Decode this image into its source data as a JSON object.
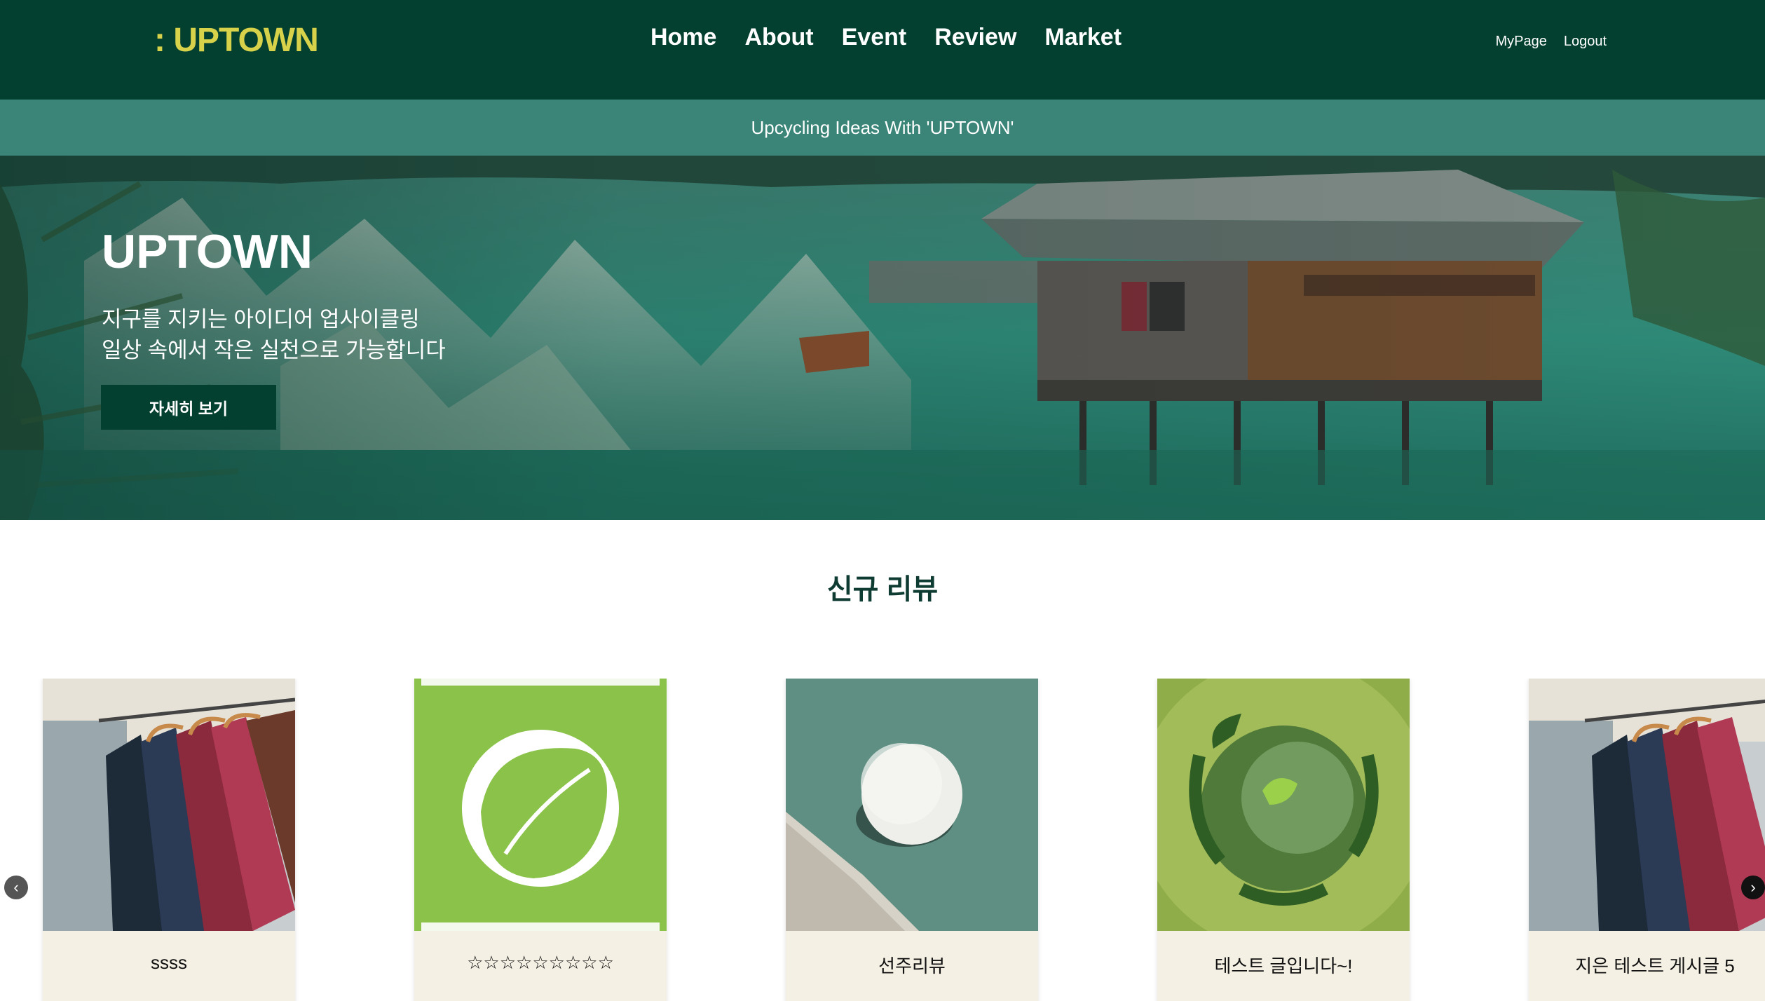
{
  "header": {
    "logo": ": UPTOWN",
    "nav": [
      "Home",
      "About",
      "Event",
      "Review",
      "Market"
    ],
    "account": [
      "MyPage",
      "Logout"
    ]
  },
  "slogan": "Upcycling Ideas With 'UPTOWN'",
  "hero": {
    "title": "UPTOWN",
    "line1": "지구를 지키는 아이디어 업사이클링",
    "line2": "일상 속에서 작은 실천으로 가능합니다",
    "button": "자세히 보기"
  },
  "section": {
    "title": "신규 리뷰"
  },
  "cards": [
    {
      "title": "ssss",
      "image": "clothes-rack"
    },
    {
      "title": "☆☆☆☆☆☆☆☆☆",
      "image": "earth-friendly-leaf"
    },
    {
      "title": "선주리뷰",
      "image": "stone-ball"
    },
    {
      "title": "테스트 글입니다~!",
      "image": "recycle-globe"
    },
    {
      "title": "지은 테스트 게시글 5",
      "image": "clothes-rack"
    }
  ],
  "carousel": {
    "prev_icon": "chevron-left-icon",
    "next_icon": "chevron-right-icon"
  },
  "colors": {
    "header_bg": "#03402f",
    "logo": "#d8d24a",
    "slogan_bg": "#3a8478",
    "card_bg": "#f5f0e4",
    "section_title": "#0e3b32"
  }
}
